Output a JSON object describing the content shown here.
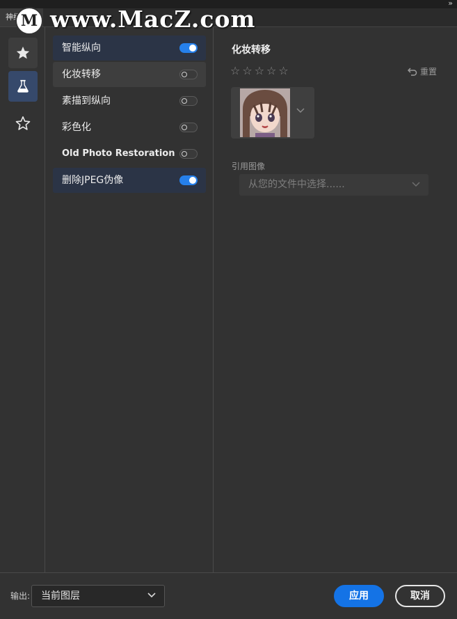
{
  "window": {
    "tab_title": "神经滤镜",
    "collapse_glyph": "»"
  },
  "watermark": {
    "text": "www.MacZ.com",
    "logo_letter": "M"
  },
  "nav": {
    "items": [
      {
        "id": "featured",
        "icon": "star-filled-icon",
        "selected": false
      },
      {
        "id": "beta",
        "icon": "flask-icon",
        "selected": true
      },
      {
        "id": "wait-list",
        "icon": "star-outline-icon",
        "selected": false
      }
    ]
  },
  "filters": {
    "items": [
      {
        "label": "智能纵向",
        "enabled": true,
        "highlight": "on"
      },
      {
        "label": "化妆转移",
        "enabled": false,
        "highlight": "hover"
      },
      {
        "label": "素描到纵向",
        "enabled": false,
        "highlight": ""
      },
      {
        "label": "彩色化",
        "enabled": false,
        "highlight": ""
      },
      {
        "label": "Old Photo Restoration",
        "enabled": false,
        "highlight": ""
      },
      {
        "label": "删除JPEG伪像",
        "enabled": true,
        "highlight": "on"
      }
    ]
  },
  "detail": {
    "title": "化妆转移",
    "rating": {
      "max": 5,
      "value": 0,
      "glyph": "☆"
    },
    "reset_label": "重置",
    "reference_label": "引用图像",
    "reference_placeholder": "从您的文件中选择......"
  },
  "footer": {
    "output_label": "输出:",
    "output_value": "当前图层",
    "apply_label": "应用",
    "cancel_label": "取消"
  },
  "colors": {
    "accent": "#1473e6",
    "toggle_on": "#2680eb",
    "panel_bg": "#323232",
    "selected_nav": "#36496b"
  }
}
